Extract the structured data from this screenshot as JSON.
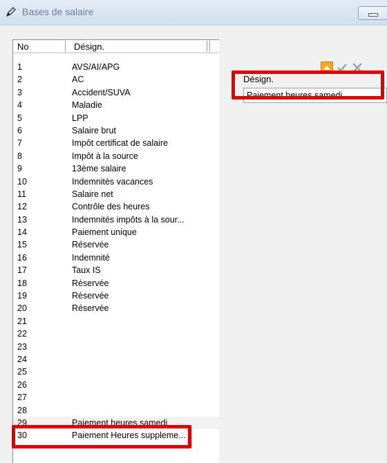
{
  "window": {
    "title": "Bases de salaire",
    "icon": "pencil-icon",
    "buttons": [
      "minimize-icon"
    ]
  },
  "list": {
    "columns": [
      "No",
      "Désign."
    ],
    "rows": [
      {
        "no": "1",
        "label": "AVS/AI/APG"
      },
      {
        "no": "2",
        "label": "AC"
      },
      {
        "no": "3",
        "label": "Accident/SUVA"
      },
      {
        "no": "4",
        "label": "Maladie"
      },
      {
        "no": "5",
        "label": "LPP"
      },
      {
        "no": "6",
        "label": "Salaire brut"
      },
      {
        "no": "7",
        "label": "Impôt certificat de salaire"
      },
      {
        "no": "8",
        "label": "Impôt à la source"
      },
      {
        "no": "9",
        "label": "13ème salaire"
      },
      {
        "no": "10",
        "label": "Indemnités vacances"
      },
      {
        "no": "11",
        "label": "Salaire net"
      },
      {
        "no": "12",
        "label": "Contrôle des heures"
      },
      {
        "no": "13",
        "label": "Indemnités impôts à la sour..."
      },
      {
        "no": "14",
        "label": "Paiement unique"
      },
      {
        "no": "15",
        "label": "Réservée"
      },
      {
        "no": "16",
        "label": "Indemnité"
      },
      {
        "no": "17",
        "label": "Taux IS"
      },
      {
        "no": "18",
        "label": "Réservée"
      },
      {
        "no": "19",
        "label": "Réservée"
      },
      {
        "no": "20",
        "label": "Réservée"
      },
      {
        "no": "21",
        "label": ""
      },
      {
        "no": "22",
        "label": ""
      },
      {
        "no": "23",
        "label": ""
      },
      {
        "no": "24",
        "label": ""
      },
      {
        "no": "25",
        "label": ""
      },
      {
        "no": "26",
        "label": ""
      },
      {
        "no": "27",
        "label": ""
      },
      {
        "no": "28",
        "label": ""
      },
      {
        "no": "29",
        "label": "Paiement heures samedi",
        "selected": true
      },
      {
        "no": "30",
        "label": "Paiement Heures suppleme..."
      }
    ]
  },
  "detail": {
    "label": "Désign.",
    "value": "Paiement heures samedi",
    "toolbar": [
      "up-arrow-icon",
      "check-icon",
      "close-icon"
    ]
  },
  "colors": {
    "highlight": "#e00000",
    "accent_orange": "#f5a623",
    "titlebar": "#d2dfee"
  }
}
